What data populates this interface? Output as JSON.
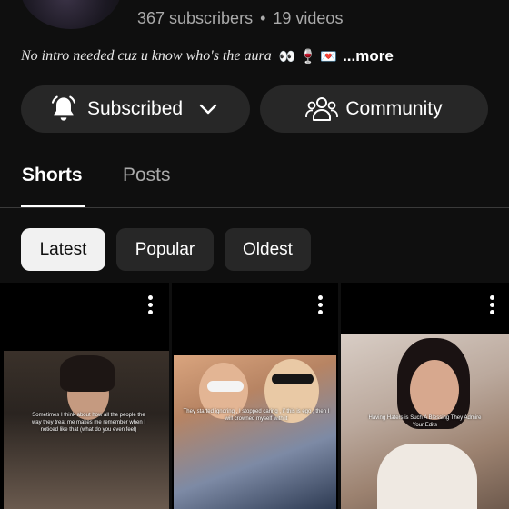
{
  "channel": {
    "name_partial": "",
    "subscribers": "367 subscribers",
    "separator": "•",
    "videos": "19 videos",
    "description": "No intro needed cuz u know who's the aura",
    "description_emoji": "👀 🍷 💌",
    "more_label": "...more"
  },
  "actions": {
    "subscribed_label": "Subscribed",
    "community_label": "Community"
  },
  "tabs": [
    {
      "label": "Shorts",
      "active": true
    },
    {
      "label": "Posts",
      "active": false
    }
  ],
  "chips": [
    {
      "label": "Latest",
      "selected": true
    },
    {
      "label": "Popular",
      "selected": false
    },
    {
      "label": "Oldest",
      "selected": false
    }
  ],
  "shorts": [
    {
      "caption": "Sometimes I think about how all the people the way they treat me makes me remember when I noticed like that (what do you even feel)"
    },
    {
      "caption": "They started ignoring , I stopped caring , if this is ego , then I will crowned myself with it"
    },
    {
      "caption": "Having Haters is Such A Blessing They Admire Your Edits"
    }
  ],
  "colors": {
    "background": "#0f0f0f",
    "button_bg": "#272727",
    "selected_chip_bg": "#f1f1f1",
    "secondary_text": "#aaaaaa"
  },
  "icons": {
    "bell": "bell-icon",
    "chevron": "chevron-down-icon",
    "community": "people-icon",
    "more": "more-vert-icon"
  }
}
